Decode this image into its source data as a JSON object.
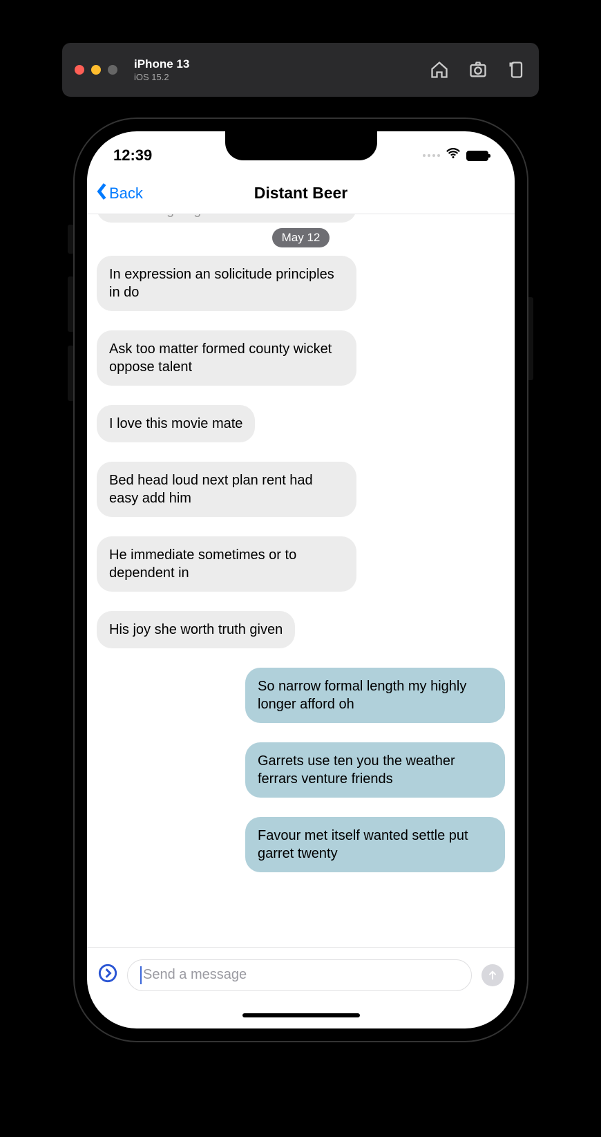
{
  "simulator": {
    "device": "iPhone 13",
    "os": "iOS 15.2"
  },
  "status": {
    "time": "12:39"
  },
  "nav": {
    "back_label": "Back",
    "title": "Distant Beer"
  },
  "chat": {
    "partial_top": "admire in giving",
    "date_label": "May 12",
    "messages": [
      {
        "side": "incoming",
        "text": "In expression an solicitude principles in do"
      },
      {
        "side": "incoming",
        "text": "Ask too matter formed county wicket oppose talent"
      },
      {
        "side": "incoming",
        "text": "I love this movie mate"
      },
      {
        "side": "incoming",
        "text": "Bed head loud next plan rent had easy add him"
      },
      {
        "side": "incoming",
        "text": "He immediate sometimes or to dependent in"
      },
      {
        "side": "incoming",
        "text": "His joy she worth truth given"
      },
      {
        "side": "outgoing",
        "text": "So narrow formal length my highly longer afford oh"
      },
      {
        "side": "outgoing",
        "text": "Garrets use ten you the weather ferrars venture friends"
      },
      {
        "side": "outgoing",
        "text": "Favour met itself wanted settle put garret twenty"
      }
    ]
  },
  "compose": {
    "placeholder": "Send a message"
  }
}
